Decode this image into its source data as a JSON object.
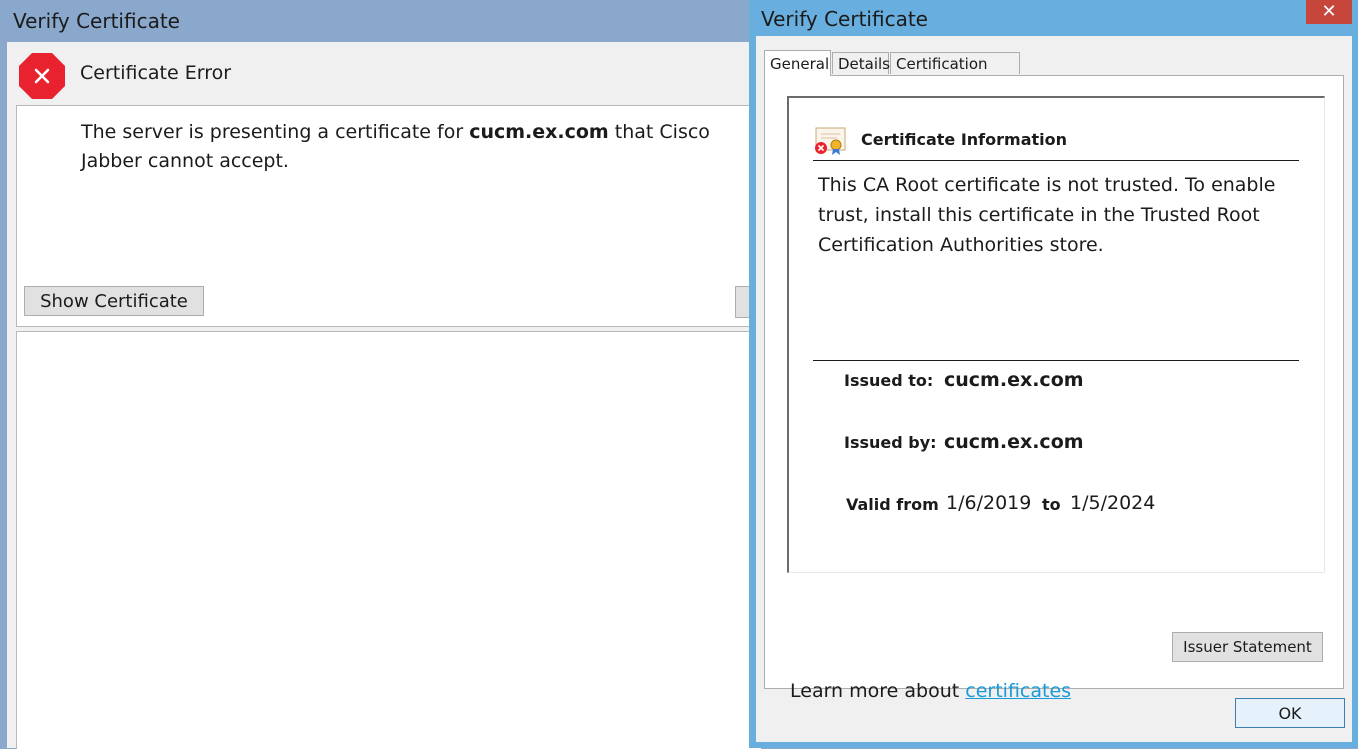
{
  "background_dialog": {
    "title": "Verify Certificate",
    "header": "Certificate Error",
    "message_prefix": "The server is presenting a certificate for ",
    "message_host": "cucm.ex.com",
    "message_suffix": " that Cisco Jabber cannot accept.",
    "show_certificate_label": "Show Certificate"
  },
  "cert_dialog": {
    "title": "Verify Certificate",
    "close_glyph": "✕",
    "tabs": [
      {
        "label": "General",
        "selected": true
      },
      {
        "label": "Details",
        "selected": false
      },
      {
        "label": "Certification Path",
        "selected": false
      }
    ],
    "info_heading": "Certificate Information",
    "info_text": "This CA Root certificate is not trusted. To enable trust, install this certificate in the Trusted Root Certification Authorities store.",
    "issued_to_label": "Issued to:",
    "issued_to_value": "cucm.ex.com",
    "issued_by_label": "Issued by:",
    "issued_by_value": "cucm.ex.com",
    "valid_from_label": "Valid from",
    "valid_from_value": "1/6/2019",
    "valid_to_label": "to",
    "valid_to_value": "1/5/2024",
    "issuer_statement_label": "Issuer Statement",
    "learn_more_prefix": "Learn more about ",
    "learn_more_link": "certificates",
    "ok_label": "OK"
  },
  "colors": {
    "error_red": "#e8232f",
    "title_bar_active": "#68afe0",
    "title_bar_inactive": "#8aa8cc",
    "link": "#1a9ad6"
  },
  "icons": {
    "error": "error-octagon-icon",
    "certificate": "certificate-error-icon",
    "close": "close-icon"
  }
}
